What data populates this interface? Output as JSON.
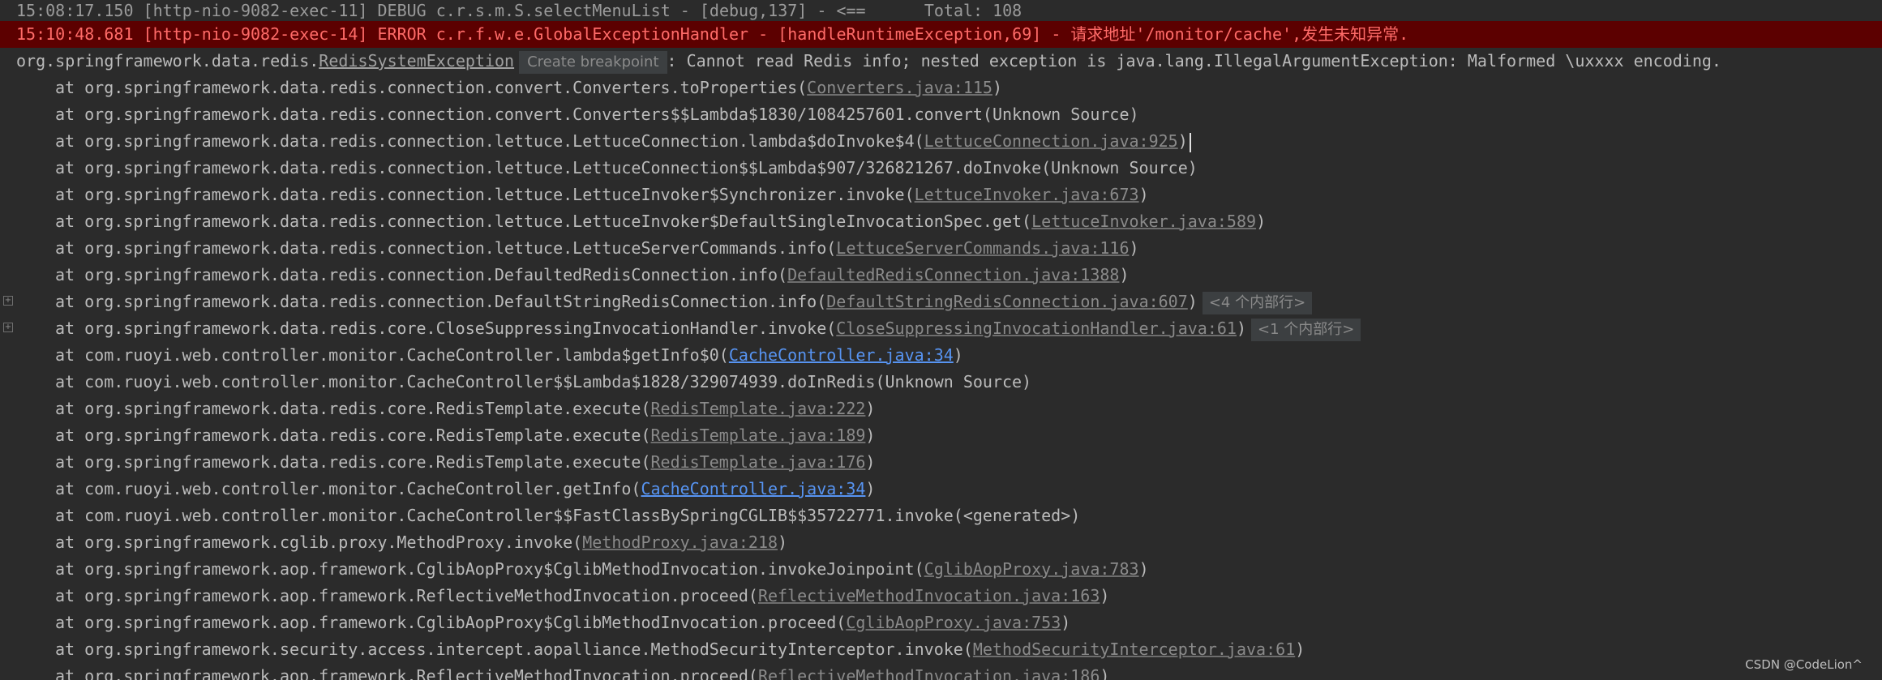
{
  "console": {
    "debug_line": "15:08:17.150 [http-nio-9082-exec-11] DEBUG c.r.s.m.S.selectMenuList - [debug,137] - <==      Total: 108",
    "error_line": "15:10:48.681 [http-nio-9082-exec-14] ERROR c.r.f.w.e.GlobalExceptionHandler - [handleRuntimeException,69] - 请求地址'/monitor/cache',发生未知异常.",
    "exception": {
      "prefix": "org.springframework.data.redis.",
      "class_name": "RedisSystemException",
      "breakpoint_label": "Create breakpoint",
      "message": ": Cannot read Redis info; nested exception is java.lang.IllegalArgumentException: Malformed \\uxxxx encoding."
    },
    "stack": [
      {
        "text": "at org.springframework.data.redis.connection.convert.Converters.toProperties(",
        "link": "Converters.java:115",
        "suffix": ")"
      },
      {
        "text": "at org.springframework.data.redis.connection.convert.Converters$$Lambda$1830/1084257601.convert(Unknown Source)"
      },
      {
        "text": "at org.springframework.data.redis.connection.lettuce.LettuceConnection.lambda$doInvoke$4(",
        "link": "LettuceConnection.java:925",
        "suffix": ")"
      },
      {
        "text": "at org.springframework.data.redis.connection.lettuce.LettuceConnection$$Lambda$907/326821267.doInvoke(Unknown Source)"
      },
      {
        "text": "at org.springframework.data.redis.connection.lettuce.LettuceInvoker$Synchronizer.invoke(",
        "link": "LettuceInvoker.java:673",
        "suffix": ")"
      },
      {
        "text": "at org.springframework.data.redis.connection.lettuce.LettuceInvoker$DefaultSingleInvocationSpec.get(",
        "link": "LettuceInvoker.java:589",
        "suffix": ")"
      },
      {
        "text": "at org.springframework.data.redis.connection.lettuce.LettuceServerCommands.info(",
        "link": "LettuceServerCommands.java:116",
        "suffix": ")"
      },
      {
        "text": "at org.springframework.data.redis.connection.DefaultedRedisConnection.info(",
        "link": "DefaultedRedisConnection.java:1388",
        "suffix": ")"
      },
      {
        "text": "at org.springframework.data.redis.connection.DefaultStringRedisConnection.info(",
        "link": "DefaultStringRedisConnection.java:607",
        "suffix": ")",
        "folded": "<4 个内部行>"
      },
      {
        "text": "at org.springframework.data.redis.core.CloseSuppressingInvocationHandler.invoke(",
        "link": "CloseSuppressingInvocationHandler.java:61",
        "suffix": ")",
        "folded": "<1 个内部行>"
      },
      {
        "text": "at com.ruoyi.web.controller.monitor.CacheController.lambda$getInfo$0(",
        "link": "CacheController.java:34",
        "suffix": ")"
      },
      {
        "text": "at com.ruoyi.web.controller.monitor.CacheController$$Lambda$1828/329074939.doInRedis(Unknown Source)"
      },
      {
        "text": "at org.springframework.data.redis.core.RedisTemplate.execute(",
        "link": "RedisTemplate.java:222",
        "suffix": ")"
      },
      {
        "text": "at org.springframework.data.redis.core.RedisTemplate.execute(",
        "link": "RedisTemplate.java:189",
        "suffix": ")"
      },
      {
        "text": "at org.springframework.data.redis.core.RedisTemplate.execute(",
        "link": "RedisTemplate.java:176",
        "suffix": ")"
      },
      {
        "text": "at com.ruoyi.web.controller.monitor.CacheController.getInfo(",
        "link": "CacheController.java:34",
        "suffix": ")"
      },
      {
        "text": "at com.ruoyi.web.controller.monitor.CacheController$$FastClassBySpringCGLIB$$35722771.invoke(<generated>)"
      },
      {
        "text": "at org.springframework.cglib.proxy.MethodProxy.invoke(",
        "link": "MethodProxy.java:218",
        "suffix": ")"
      },
      {
        "text": "at org.springframework.aop.framework.CglibAopProxy$CglibMethodInvocation.invokeJoinpoint(",
        "link": "CglibAopProxy.java:783",
        "suffix": ")"
      },
      {
        "text": "at org.springframework.aop.framework.ReflectiveMethodInvocation.proceed(",
        "link": "ReflectiveMethodInvocation.java:163",
        "suffix": ")"
      },
      {
        "text": "at org.springframework.aop.framework.CglibAopProxy$CglibMethodInvocation.proceed(",
        "link": "CglibAopProxy.java:753",
        "suffix": ")"
      },
      {
        "text": "at org.springframework.security.access.intercept.aopalliance.MethodSecurityInterceptor.invoke(",
        "link": "MethodSecurityInterceptor.java:61",
        "suffix": ")"
      },
      {
        "text": "at org.springframework.aop.framework.ReflectiveMethodInvocation.proceed(",
        "link": "ReflectiveMethodInvocation.java:186",
        "suffix": ")"
      }
    ]
  },
  "watermark": "CSDN @CodeLion^"
}
